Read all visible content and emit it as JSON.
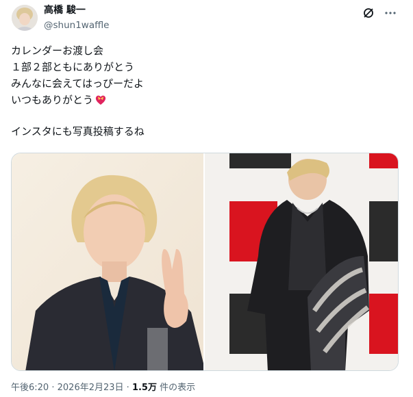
{
  "author": {
    "display_name": "高橋 駿一",
    "handle": "@shun1waffle"
  },
  "icons": {
    "grok": "grok-icon",
    "more": "more-icon",
    "heart_emoji": "heart-with-ribbon-emoji"
  },
  "post": {
    "lines": [
      "カレンダーお渡し会",
      "１部２部ともにありがとう",
      "みんなに会えてはっぴーだよ",
      "いつもありがとう"
    ],
    "last_line": "インスタにも写真投稿するね"
  },
  "media": {
    "photo_count": 2
  },
  "meta": {
    "time": "午後6:20",
    "separator1": "·",
    "date": "2026年2月23日",
    "separator2": "·",
    "views_count": "1.5万",
    "views_label": "件の表示"
  },
  "colors": {
    "text": "#0f1419",
    "secondary": "#536471",
    "border": "#cfd9de",
    "backdrop_red": "#d9141f"
  }
}
